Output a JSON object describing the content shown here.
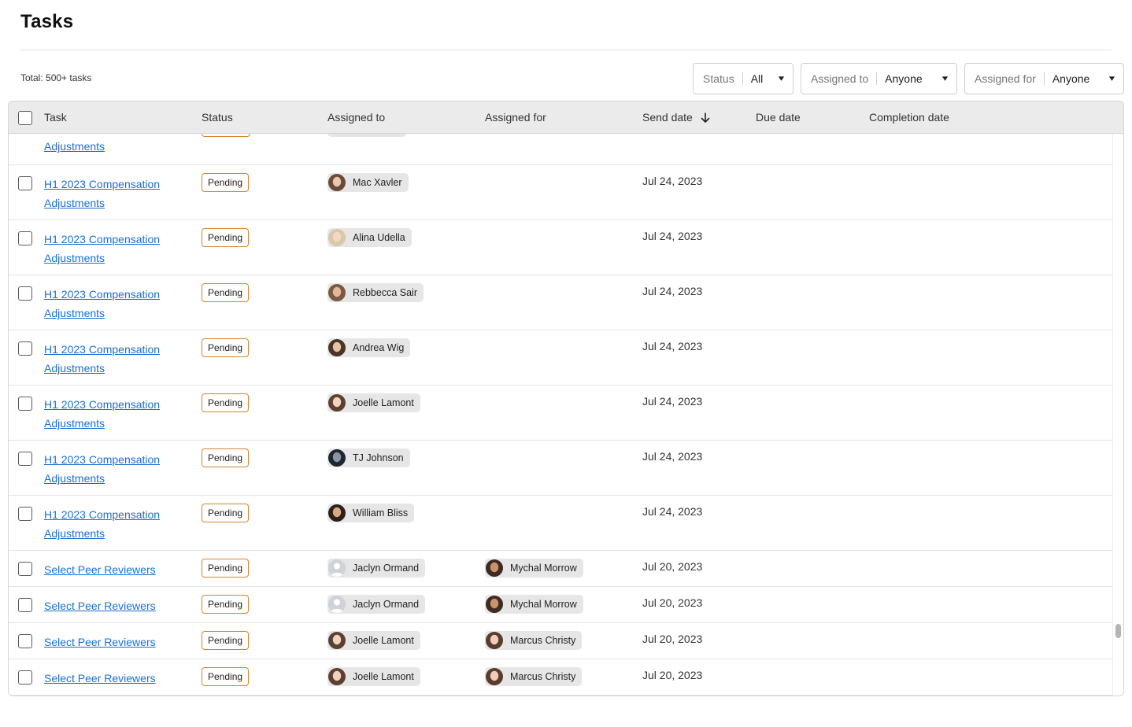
{
  "page": {
    "title": "Tasks",
    "total_label": "Total: 500+ tasks"
  },
  "filters": {
    "status": {
      "label": "Status",
      "value": "All"
    },
    "assigned_to": {
      "label": "Assigned to",
      "value": "Anyone"
    },
    "assigned_for": {
      "label": "Assigned for",
      "value": "Anyone"
    }
  },
  "table": {
    "columns": {
      "task": "Task",
      "status": "Status",
      "assigned_to": "Assigned to",
      "assigned_for": "Assigned for",
      "send_date": "Send date",
      "due_date": "Due date",
      "completion_date": "Completion date"
    },
    "partial_row": {
      "task_tail": "Adjustments"
    },
    "rows": [
      {
        "task": "H1 2023 Compensation Adjustments",
        "status": "Pending",
        "assigned_to": "Mac Xavler",
        "assigned_for": "",
        "send_date": "Jul 24, 2023",
        "avatar_to": "person-a"
      },
      {
        "task": "H1 2023 Compensation Adjustments",
        "status": "Pending",
        "assigned_to": "Alina Udella",
        "assigned_for": "",
        "send_date": "Jul 24, 2023",
        "avatar_to": "person-b"
      },
      {
        "task": "H1 2023 Compensation Adjustments",
        "status": "Pending",
        "assigned_to": "Rebbecca Sair",
        "assigned_for": "",
        "send_date": "Jul 24, 2023",
        "avatar_to": "person-c"
      },
      {
        "task": "H1 2023 Compensation Adjustments",
        "status": "Pending",
        "assigned_to": "Andrea Wig",
        "assigned_for": "",
        "send_date": "Jul 24, 2023",
        "avatar_to": "person-d"
      },
      {
        "task": "H1 2023 Compensation Adjustments",
        "status": "Pending",
        "assigned_to": "Joelle Lamont",
        "assigned_for": "",
        "send_date": "Jul 24, 2023",
        "avatar_to": "person-e"
      },
      {
        "task": "H1 2023 Compensation Adjustments",
        "status": "Pending",
        "assigned_to": "TJ Johnson",
        "assigned_for": "",
        "send_date": "Jul 24, 2023",
        "avatar_to": "person-f"
      },
      {
        "task": "H1 2023 Compensation Adjustments",
        "status": "Pending",
        "assigned_to": "William Bliss",
        "assigned_for": "",
        "send_date": "Jul 24, 2023",
        "avatar_to": "person-g"
      },
      {
        "task": "Select Peer Reviewers",
        "status": "Pending",
        "assigned_to": "Jaclyn Ormand",
        "assigned_for": "Mychal Morrow",
        "send_date": "Jul 20, 2023",
        "avatar_to": "placeholder",
        "avatar_for": "person-h"
      },
      {
        "task": "Select Peer Reviewers",
        "status": "Pending",
        "assigned_to": "Jaclyn Ormand",
        "assigned_for": "Mychal Morrow",
        "send_date": "Jul 20, 2023",
        "avatar_to": "placeholder",
        "avatar_for": "person-h"
      },
      {
        "task": "Select Peer Reviewers",
        "status": "Pending",
        "assigned_to": "Joelle Lamont",
        "assigned_for": "Marcus Christy",
        "send_date": "Jul 20, 2023",
        "avatar_to": "person-e",
        "avatar_for": "person-i"
      },
      {
        "task": "Select Peer Reviewers",
        "status": "Pending",
        "assigned_to": "Joelle Lamont",
        "assigned_for": "Marcus Christy",
        "send_date": "Jul 20, 2023",
        "avatar_to": "person-e",
        "avatar_for": "person-i"
      }
    ]
  },
  "colors": {
    "link": "#1a6fd3",
    "pending_border": "#d9822b",
    "header_bg": "#ebebeb",
    "chip_bg": "#e6e6e6"
  },
  "icons": {
    "caret": "caret-down-icon",
    "sort": "arrow-down-icon",
    "avatar": "user-avatar-icon"
  }
}
